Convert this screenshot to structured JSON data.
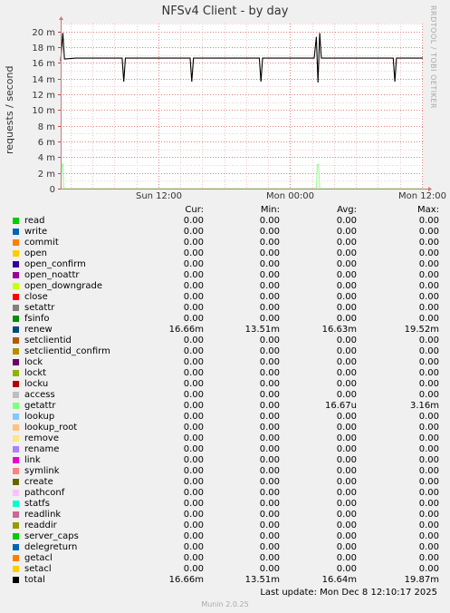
{
  "title": "NFSv4 Client - by day",
  "credit": "RRDTOOL / TOBI OETIKER",
  "chart_data": {
    "type": "line",
    "title": "NFSv4 Client - by day",
    "ylabel": "requests / second",
    "ylim": [
      0,
      21
    ],
    "yticks": [
      {
        "value": 0,
        "label": "0"
      },
      {
        "value": 2,
        "label": "2 m"
      },
      {
        "value": 4,
        "label": "4 m"
      },
      {
        "value": 6,
        "label": "6 m"
      },
      {
        "value": 8,
        "label": "8 m"
      },
      {
        "value": 10,
        "label": "10 m"
      },
      {
        "value": 12,
        "label": "12 m"
      },
      {
        "value": 14,
        "label": "14 m"
      },
      {
        "value": 16,
        "label": "16 m"
      },
      {
        "value": 18,
        "label": "18 m"
      },
      {
        "value": 20,
        "label": "20 m"
      }
    ],
    "xticks": [
      {
        "hour": 12,
        "label": "Sun 12:00"
      },
      {
        "hour": 24,
        "label": "Mon 00:00"
      },
      {
        "hour": 36,
        "label": "Mon 12:00"
      }
    ],
    "xlim_hours": [
      3.1,
      36.1
    ],
    "grid": true,
    "series": [
      {
        "name": "total",
        "color": "#000000",
        "points": [
          [
            3.1,
            16.2
          ],
          [
            3.3,
            19.8
          ],
          [
            3.45,
            16.5
          ],
          [
            4.5,
            16.6
          ],
          [
            6.0,
            16.6
          ],
          [
            8.0,
            16.6
          ],
          [
            8.7,
            16.6
          ],
          [
            8.85,
            13.6
          ],
          [
            9.0,
            16.6
          ],
          [
            11.0,
            16.6
          ],
          [
            13.0,
            16.6
          ],
          [
            14.9,
            16.6
          ],
          [
            15.05,
            13.6
          ],
          [
            15.2,
            16.6
          ],
          [
            17.5,
            16.6
          ],
          [
            19.0,
            16.6
          ],
          [
            21.2,
            16.6
          ],
          [
            21.35,
            13.6
          ],
          [
            21.5,
            16.6
          ],
          [
            24.0,
            16.6
          ],
          [
            26.2,
            16.6
          ],
          [
            26.4,
            19.3
          ],
          [
            26.55,
            13.5
          ],
          [
            26.7,
            19.8
          ],
          [
            26.85,
            16.6
          ],
          [
            29.0,
            16.6
          ],
          [
            31.0,
            16.6
          ],
          [
            33.4,
            16.6
          ],
          [
            33.55,
            13.6
          ],
          [
            33.7,
            16.6
          ],
          [
            35.0,
            16.6
          ],
          [
            36.1,
            16.6
          ]
        ]
      },
      {
        "name": "getattr",
        "color": "#99ff99",
        "points": [
          [
            3.1,
            0
          ],
          [
            3.2,
            3.1
          ],
          [
            3.3,
            3.1
          ],
          [
            3.4,
            0
          ],
          [
            26.4,
            0
          ],
          [
            26.5,
            3.1
          ],
          [
            26.6,
            3.1
          ],
          [
            26.7,
            0
          ],
          [
            36.1,
            0
          ]
        ]
      }
    ]
  },
  "legend": {
    "headers": {
      "cur": "Cur:",
      "min": "Min:",
      "avg": "Avg:",
      "max": "Max:"
    },
    "rows": [
      {
        "name": "read",
        "color": "#00cc00",
        "cur": "0.00",
        "min": "0.00",
        "avg": "0.00",
        "max": "0.00"
      },
      {
        "name": "write",
        "color": "#0066b3",
        "cur": "0.00",
        "min": "0.00",
        "avg": "0.00",
        "max": "0.00"
      },
      {
        "name": "commit",
        "color": "#ff8000",
        "cur": "0.00",
        "min": "0.00",
        "avg": "0.00",
        "max": "0.00"
      },
      {
        "name": "open",
        "color": "#ffcc00",
        "cur": "0.00",
        "min": "0.00",
        "avg": "0.00",
        "max": "0.00"
      },
      {
        "name": "open_confirm",
        "color": "#330099",
        "cur": "0.00",
        "min": "0.00",
        "avg": "0.00",
        "max": "0.00"
      },
      {
        "name": "open_noattr",
        "color": "#990099",
        "cur": "0.00",
        "min": "0.00",
        "avg": "0.00",
        "max": "0.00"
      },
      {
        "name": "open_downgrade",
        "color": "#ccff00",
        "cur": "0.00",
        "min": "0.00",
        "avg": "0.00",
        "max": "0.00"
      },
      {
        "name": "close",
        "color": "#ff0000",
        "cur": "0.00",
        "min": "0.00",
        "avg": "0.00",
        "max": "0.00"
      },
      {
        "name": "setattr",
        "color": "#808080",
        "cur": "0.00",
        "min": "0.00",
        "avg": "0.00",
        "max": "0.00"
      },
      {
        "name": "fsinfo",
        "color": "#008f00",
        "cur": "0.00",
        "min": "0.00",
        "avg": "0.00",
        "max": "0.00"
      },
      {
        "name": "renew",
        "color": "#00487d",
        "cur": "16.66m",
        "min": "13.51m",
        "avg": "16.63m",
        "max": "19.52m"
      },
      {
        "name": "setclientid",
        "color": "#b35a00",
        "cur": "0.00",
        "min": "0.00",
        "avg": "0.00",
        "max": "0.00"
      },
      {
        "name": "setclientid_confirm",
        "color": "#b38f00",
        "cur": "0.00",
        "min": "0.00",
        "avg": "0.00",
        "max": "0.00"
      },
      {
        "name": "lock",
        "color": "#6b006b",
        "cur": "0.00",
        "min": "0.00",
        "avg": "0.00",
        "max": "0.00"
      },
      {
        "name": "lockt",
        "color": "#8fb300",
        "cur": "0.00",
        "min": "0.00",
        "avg": "0.00",
        "max": "0.00"
      },
      {
        "name": "locku",
        "color": "#b30000",
        "cur": "0.00",
        "min": "0.00",
        "avg": "0.00",
        "max": "0.00"
      },
      {
        "name": "access",
        "color": "#bebebe",
        "cur": "0.00",
        "min": "0.00",
        "avg": "0.00",
        "max": "0.00"
      },
      {
        "name": "getattr",
        "color": "#80ff80",
        "cur": "0.00",
        "min": "0.00",
        "avg": "16.67u",
        "max": "3.16m"
      },
      {
        "name": "lookup",
        "color": "#80c9ff",
        "cur": "0.00",
        "min": "0.00",
        "avg": "0.00",
        "max": "0.00"
      },
      {
        "name": "lookup_root",
        "color": "#ffc080",
        "cur": "0.00",
        "min": "0.00",
        "avg": "0.00",
        "max": "0.00"
      },
      {
        "name": "remove",
        "color": "#ffe680",
        "cur": "0.00",
        "min": "0.00",
        "avg": "0.00",
        "max": "0.00"
      },
      {
        "name": "rename",
        "color": "#aa80ff",
        "cur": "0.00",
        "min": "0.00",
        "avg": "0.00",
        "max": "0.00"
      },
      {
        "name": "link",
        "color": "#ee00cc",
        "cur": "0.00",
        "min": "0.00",
        "avg": "0.00",
        "max": "0.00"
      },
      {
        "name": "symlink",
        "color": "#ff8080",
        "cur": "0.00",
        "min": "0.00",
        "avg": "0.00",
        "max": "0.00"
      },
      {
        "name": "create",
        "color": "#666600",
        "cur": "0.00",
        "min": "0.00",
        "avg": "0.00",
        "max": "0.00"
      },
      {
        "name": "pathconf",
        "color": "#ffbfff",
        "cur": "0.00",
        "min": "0.00",
        "avg": "0.00",
        "max": "0.00"
      },
      {
        "name": "statfs",
        "color": "#00ffcc",
        "cur": "0.00",
        "min": "0.00",
        "avg": "0.00",
        "max": "0.00"
      },
      {
        "name": "readlink",
        "color": "#cc6699",
        "cur": "0.00",
        "min": "0.00",
        "avg": "0.00",
        "max": "0.00"
      },
      {
        "name": "readdir",
        "color": "#999900",
        "cur": "0.00",
        "min": "0.00",
        "avg": "0.00",
        "max": "0.00"
      },
      {
        "name": "server_caps",
        "color": "#00cc00",
        "cur": "0.00",
        "min": "0.00",
        "avg": "0.00",
        "max": "0.00"
      },
      {
        "name": "delegreturn",
        "color": "#0066b3",
        "cur": "0.00",
        "min": "0.00",
        "avg": "0.00",
        "max": "0.00"
      },
      {
        "name": "getacl",
        "color": "#ff8000",
        "cur": "0.00",
        "min": "0.00",
        "avg": "0.00",
        "max": "0.00"
      },
      {
        "name": "setacl",
        "color": "#ffcc00",
        "cur": "0.00",
        "min": "0.00",
        "avg": "0.00",
        "max": "0.00"
      },
      {
        "name": "total",
        "color": "#000000",
        "cur": "16.66m",
        "min": "13.51m",
        "avg": "16.64m",
        "max": "19.87m"
      }
    ]
  },
  "last_update": "Last update:  Mon Dec  8 12:10:17 2025",
  "footer": "Munin 2.0.25"
}
